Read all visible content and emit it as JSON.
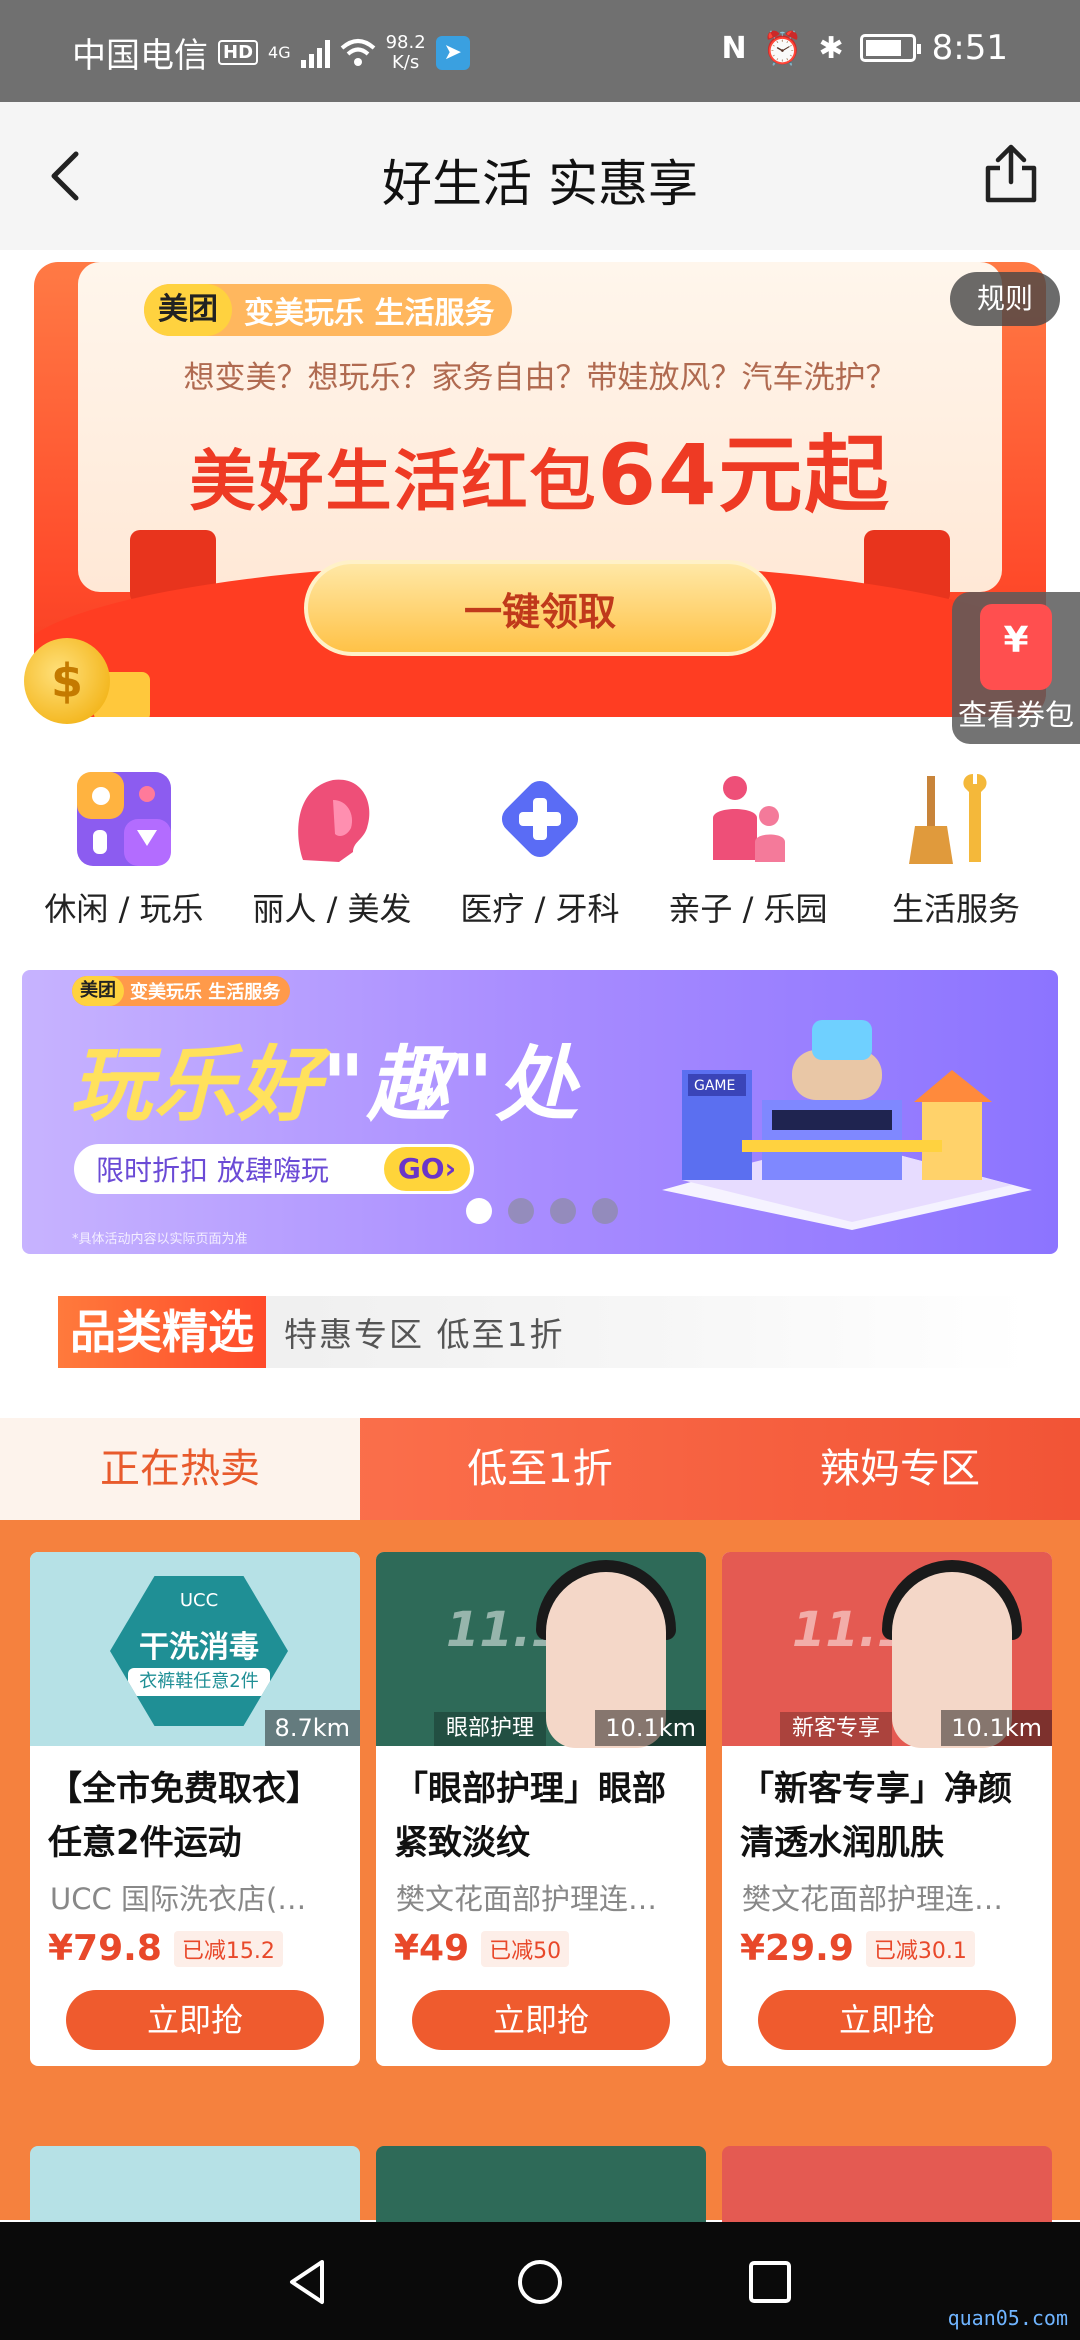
{
  "status_bar": {
    "carrier": "中国电信",
    "hd": "HD",
    "network": "4G",
    "speed_value": "98.2",
    "speed_unit": "K/s",
    "time": "8:51"
  },
  "nav": {
    "title": "好生活 实惠享"
  },
  "hero": {
    "brand": "美团",
    "tag": "变美玩乐 生活服务",
    "subtitle": "想变美？想玩乐？家务自由？带娃放风？汽车洗护？",
    "title_prefix": "美好生活红包",
    "title_amount": "64元起",
    "button": "一键领取",
    "rules": "规则",
    "coupon_label": "查看券包",
    "coupon_symbol": "¥",
    "coin_symbol": "$"
  },
  "categories": [
    {
      "label": "休闲 / 玩乐",
      "icon": "leisure-icon"
    },
    {
      "label": "丽人 / 美发",
      "icon": "beauty-icon"
    },
    {
      "label": "医疗 / 牙科",
      "icon": "medical-icon"
    },
    {
      "label": "亲子 / 乐园",
      "icon": "family-icon"
    },
    {
      "label": "生活服务",
      "icon": "life-service-icon"
    }
  ],
  "banner2": {
    "brand": "美团",
    "tag": "变美玩乐 生活服务",
    "title_a": "玩乐好",
    "title_b": "\"趣\"",
    "title_c": "处",
    "pill": "限时折扣 放肆嗨玩",
    "go": "GO›",
    "footnote": "*具体活动内容以实际页面为准",
    "sign": "GAME",
    "slides": 4,
    "active_slide": 1
  },
  "pick": {
    "tag": "品类精选",
    "text": "特惠专区 低至1折"
  },
  "tabs": [
    {
      "label": "正在热卖",
      "active": true
    },
    {
      "label": "低至1折",
      "active": false
    },
    {
      "label": "辣妈专区",
      "active": false
    }
  ],
  "products": [
    {
      "title": "【全市免费取衣】任意2件运动",
      "shop": "UCC 国际洗衣店(…",
      "price": "¥79.8",
      "saved": "已减15.2",
      "distance": "8.7km",
      "image_tag": "",
      "image_text_brand": "UCC",
      "image_text_main": "干洗消毒",
      "image_text_sub": "衣裤鞋任意2件",
      "button": "立即抢"
    },
    {
      "title": "「眼部护理」眼部紧致淡纹",
      "shop": "樊文花面部护理连…",
      "price": "¥49",
      "saved": "已减50",
      "distance": "10.1km",
      "image_tag": "眼部护理",
      "image_big": "11.11",
      "button": "立即抢"
    },
    {
      "title": "「新客专享」净颜清透水润肌肤",
      "shop": "樊文花面部护理连…",
      "price": "¥29.9",
      "saved": "已减30.1",
      "distance": "10.1km",
      "image_tag": "新客专享",
      "image_big": "11.11",
      "button": "立即抢"
    }
  ],
  "watermark": "quan05.com"
}
